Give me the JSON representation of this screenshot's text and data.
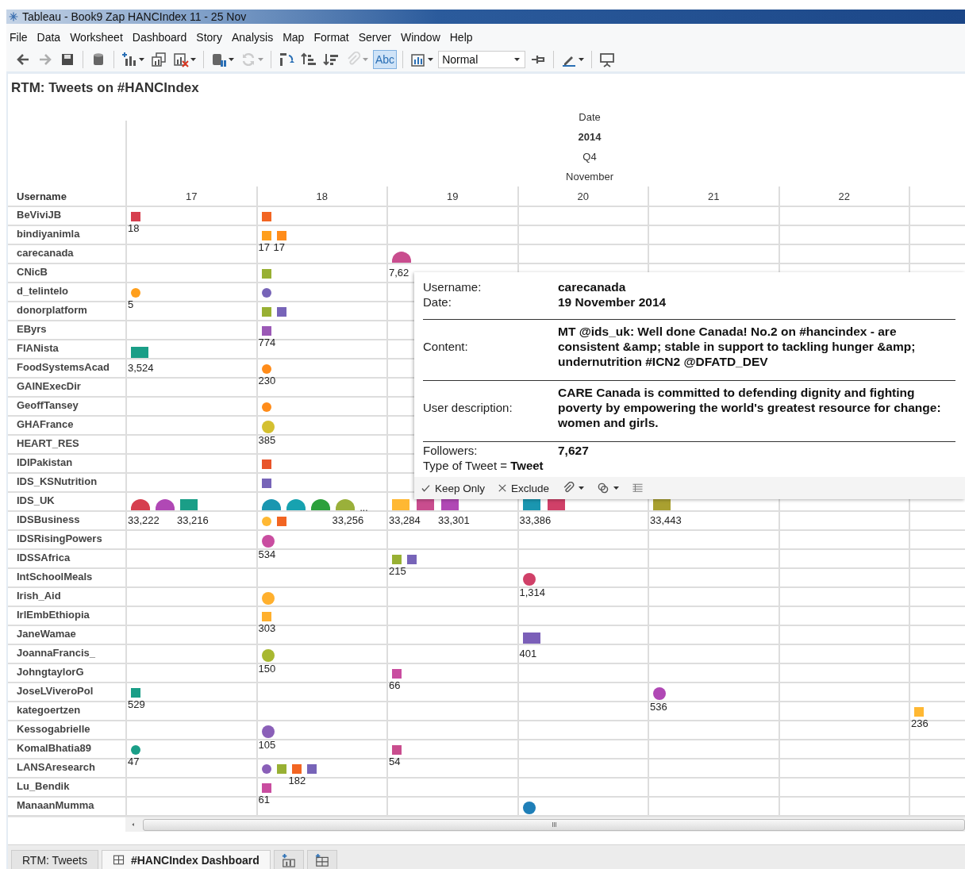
{
  "window": {
    "title": "Tableau - Book9 Zap HANCIndex 11 - 25 Nov"
  },
  "menu": [
    "File",
    "Data",
    "Worksheet",
    "Dashboard",
    "Story",
    "Analysis",
    "Map",
    "Format",
    "Server",
    "Window",
    "Help"
  ],
  "toolbar": [
    [
      {
        "kind": "icon",
        "disabled": false,
        "dropdown": false
      },
      {
        "kind": "icon",
        "disabled": true,
        "dropdown": false
      },
      {
        "kind": "icon",
        "disabled": false,
        "dropdown": false
      }
    ],
    [
      {
        "kind": "icon",
        "disabled": false,
        "dropdown": false
      }
    ],
    [
      {
        "kind": "icon",
        "disabled": false,
        "dropdown": true
      },
      {
        "kind": "icon",
        "disabled": false,
        "dropdown": false
      },
      {
        "kind": "icon",
        "disabled": false,
        "dropdown": true
      }
    ],
    [
      {
        "kind": "icon",
        "disabled": false,
        "dropdown": true
      },
      {
        "kind": "icon",
        "disabled": true,
        "dropdown": true
      }
    ],
    [
      {
        "kind": "icon",
        "disabled": false,
        "dropdown": false
      },
      {
        "kind": "icon",
        "disabled": false,
        "dropdown": false
      },
      {
        "kind": "icon",
        "disabled": false,
        "dropdown": false
      },
      {
        "kind": "icon",
        "disabled": true,
        "dropdown": true
      },
      {
        "kind": "toggle",
        "label": "Abc",
        "selected": true
      }
    ],
    [
      {
        "kind": "icon",
        "disabled": false,
        "dropdown": true
      },
      {
        "kind": "select",
        "value": "Normal"
      },
      {
        "kind": "icon",
        "disabled": false,
        "dropdown": false
      }
    ],
    [
      {
        "kind": "icon",
        "disabled": false,
        "dropdown": true
      }
    ],
    [
      {
        "kind": "icon",
        "disabled": false,
        "dropdown": false
      }
    ]
  ],
  "sheet_title": "RTM: Tweets on #HANCIndex",
  "header": {
    "field": "Date",
    "year": "2014",
    "quarter": "Q4",
    "month": "November",
    "row_field": "Username",
    "days": [
      "17",
      "18",
      "19",
      "20",
      "21",
      "22"
    ]
  },
  "rows": [
    {
      "username": "BeViviJB",
      "cells": [
        {
          "marks": [
            {
              "kind": "square",
              "color": "#d63f4f",
              "label": "18"
            }
          ]
        },
        {
          "marks": [
            {
              "kind": "square",
              "color": "#f26522"
            }
          ]
        }
      ]
    },
    {
      "username": "bindiyanimla",
      "cells": [
        {},
        {
          "marks": [
            {
              "kind": "square",
              "color": "#ff9f1c",
              "label": "17"
            },
            {
              "kind": "square",
              "color": "#ff8c1a",
              "label": "17"
            }
          ]
        }
      ]
    },
    {
      "username": "carecanada",
      "cells": [
        {},
        {},
        {
          "marks": [
            {
              "kind": "halfdisc",
              "color": "#c94d8e",
              "label": "7,62"
            }
          ]
        }
      ]
    },
    {
      "username": "CNicB",
      "cells": [
        {},
        {
          "marks": [
            {
              "kind": "square",
              "color": "#98b033"
            }
          ]
        }
      ]
    },
    {
      "username": "d_telintelo",
      "cells": [
        {
          "marks": [
            {
              "kind": "dot",
              "color": "#ff9f1c",
              "label": "5"
            }
          ]
        },
        {
          "marks": [
            {
              "kind": "dot",
              "color": "#7764b8"
            }
          ]
        }
      ]
    },
    {
      "username": "donorplatform",
      "cells": [
        {},
        {
          "marks": [
            {
              "kind": "square",
              "color": "#98b033"
            },
            {
              "kind": "square",
              "color": "#7764b8"
            }
          ]
        }
      ]
    },
    {
      "username": "EByrs",
      "cells": [
        {},
        {
          "marks": [
            {
              "kind": "square",
              "color": "#9b59b6",
              "label": "774"
            }
          ]
        }
      ]
    },
    {
      "username": "FIANista",
      "cells": [
        {
          "marks": [
            {
              "kind": "block",
              "color": "#1a9e87",
              "label": "3,524"
            }
          ]
        }
      ]
    },
    {
      "username": "FoodSystemsAcad",
      "cells": [
        {},
        {
          "marks": [
            {
              "kind": "dot",
              "color": "#ff8c1a",
              "label": "230"
            }
          ]
        }
      ]
    },
    {
      "username": "GAINExecDir",
      "cells": []
    },
    {
      "username": "GeoffTansey",
      "cells": [
        {},
        {
          "marks": [
            {
              "kind": "dot",
              "color": "#ff8c1a"
            }
          ]
        }
      ]
    },
    {
      "username": "GHAFrance",
      "cells": [
        {},
        {
          "marks": [
            {
              "kind": "circle",
              "color": "#d4c030",
              "label": "385"
            }
          ]
        }
      ]
    },
    {
      "username": "HEART_RES",
      "cells": []
    },
    {
      "username": "IDIPakistan",
      "cells": [
        {},
        {
          "marks": [
            {
              "kind": "square",
              "color": "#e8542a"
            }
          ]
        }
      ]
    },
    {
      "username": "IDS_KSNutrition",
      "cells": [
        {},
        {
          "marks": [
            {
              "kind": "square",
              "color": "#7764b8"
            }
          ]
        }
      ]
    },
    {
      "username": "IDS_UK",
      "cells": [
        {
          "marks": [
            {
              "kind": "halfdisc",
              "color": "#d63f4f",
              "label": "33,222"
            },
            {
              "kind": "halfdisc",
              "color": "#b048b5"
            },
            {
              "kind": "block",
              "color": "#1a9e87",
              "label": "33,216"
            }
          ]
        },
        {
          "marks": [
            {
              "kind": "halfdisc",
              "color": "#1a96b0"
            },
            {
              "kind": "halfdisc",
              "color": "#17a2b0"
            },
            {
              "kind": "halfdisc",
              "color": "#2ca03c"
            },
            {
              "kind": "halfdisc",
              "color": "#9ab03a",
              "label": "33,256"
            }
          ],
          "more": "..."
        },
        {
          "marks": [
            {
              "kind": "block",
              "color": "#ffb833",
              "label": "33,284"
            },
            {
              "kind": "block",
              "color": "#c94d8e"
            },
            {
              "kind": "block",
              "color": "#b048b5",
              "label": "33,301"
            }
          ]
        },
        {
          "marks": [
            {
              "kind": "block",
              "color": "#1a96b0",
              "label": "33,386"
            },
            {
              "kind": "block",
              "color": "#d04068"
            }
          ]
        },
        {
          "marks": [
            {
              "kind": "block",
              "color": "#a9a030",
              "label": "33,443"
            }
          ]
        }
      ]
    },
    {
      "username": "IDSBusiness",
      "cells": [
        {},
        {
          "marks": [
            {
              "kind": "dot",
              "color": "#ffb833"
            },
            {
              "kind": "square",
              "color": "#f26522"
            }
          ]
        }
      ]
    },
    {
      "username": "IDSRisingPowers",
      "cells": [
        {},
        {
          "marks": [
            {
              "kind": "circle",
              "color": "#c94da0",
              "label": "534"
            }
          ]
        }
      ]
    },
    {
      "username": "IDSSAfrica",
      "cells": [
        {},
        {},
        {
          "marks": [
            {
              "kind": "square",
              "color": "#98b033",
              "label": "215"
            },
            {
              "kind": "square",
              "color": "#7764b8"
            }
          ]
        }
      ]
    },
    {
      "username": "IntSchoolMeals",
      "cells": [
        {},
        {},
        {},
        {
          "marks": [
            {
              "kind": "circle",
              "color": "#d04068",
              "label": "1,314"
            }
          ]
        }
      ]
    },
    {
      "username": "Irish_Aid",
      "cells": [
        {},
        {
          "marks": [
            {
              "kind": "circle",
              "color": "#ffb02e"
            }
          ]
        }
      ]
    },
    {
      "username": "IrlEmbEthiopia",
      "cells": [
        {},
        {
          "marks": [
            {
              "kind": "square",
              "color": "#ffb02e",
              "label": "303"
            }
          ]
        }
      ]
    },
    {
      "username": "JaneWamae",
      "cells": [
        {},
        {},
        {},
        {
          "marks": [
            {
              "kind": "block",
              "color": "#7b5fb8",
              "label": "401"
            }
          ]
        }
      ]
    },
    {
      "username": "JoannaFrancis_",
      "cells": [
        {},
        {
          "marks": [
            {
              "kind": "circle",
              "color": "#a8b830",
              "label": "150"
            }
          ]
        }
      ]
    },
    {
      "username": "JohngtaylorG",
      "cells": [
        {},
        {},
        {
          "marks": [
            {
              "kind": "square",
              "color": "#c94da0",
              "label": "66"
            }
          ]
        }
      ]
    },
    {
      "username": "JoseLViveroPol",
      "cells": [
        {
          "marks": [
            {
              "kind": "square",
              "color": "#1a9e87",
              "label": "529"
            }
          ]
        },
        {},
        {},
        {},
        {
          "marks": [
            {
              "kind": "circle",
              "color": "#b048b5",
              "label": "536"
            }
          ]
        }
      ]
    },
    {
      "username": "kategoertzen",
      "cells": [
        {},
        {},
        {},
        {},
        {},
        {},
        {
          "marks": [
            {
              "kind": "square",
              "color": "#ffb833",
              "label": "236"
            }
          ]
        }
      ]
    },
    {
      "username": "Kessogabrielle",
      "cells": [
        {},
        {
          "marks": [
            {
              "kind": "circle",
              "color": "#8a5fb8",
              "label": "105"
            }
          ]
        }
      ]
    },
    {
      "username": "KomalBhatia89",
      "cells": [
        {
          "marks": [
            {
              "kind": "dot",
              "color": "#1a9e87",
              "label": "47"
            }
          ]
        },
        {},
        {
          "marks": [
            {
              "kind": "square",
              "color": "#c94d8e",
              "label": "54"
            }
          ]
        }
      ]
    },
    {
      "username": "LANSAresearch",
      "cells": [
        {},
        {
          "marks": [
            {
              "kind": "dot",
              "color": "#8a5fb8"
            },
            {
              "kind": "square",
              "color": "#98b033"
            },
            {
              "kind": "square",
              "color": "#f26522",
              "label": "182"
            },
            {
              "kind": "square",
              "color": "#7764b8"
            }
          ]
        }
      ]
    },
    {
      "username": "Lu_Bendik",
      "cells": [
        {},
        {
          "marks": [
            {
              "kind": "square",
              "color": "#c94da0",
              "label": "61"
            }
          ]
        }
      ]
    },
    {
      "username": "ManaanMumma",
      "cells": [
        {},
        {},
        {},
        {
          "marks": [
            {
              "kind": "circle",
              "color": "#1f7fb8"
            }
          ]
        }
      ]
    }
  ],
  "tooltip": {
    "fields": [
      {
        "label": "Username:",
        "value": "carecanada",
        "rule_above": false
      },
      {
        "label": "Date:",
        "value": "19 November 2014",
        "rule_above": false
      },
      {
        "label": "Content:",
        "value": "MT @ids_uk: Well done Canada! No.2 on #hancindex - are consistent &amp; stable in support to tackling hunger &amp; undernutrition #ICN2 @DFATD_DEV",
        "rule_above": true
      },
      {
        "label": "User description:",
        "value": "CARE Canada is committed to defending dignity and fighting poverty by empowering the world's greatest resource for change: women and girls.",
        "rule_above": true
      },
      {
        "label": "Followers:",
        "value": "7,627",
        "rule_above": true
      }
    ],
    "filter": "Type of Tweet  = **Tweet**",
    "actions": [
      "Keep Only",
      "Exclude"
    ]
  },
  "tabs": [
    {
      "label": "RTM: Tweets",
      "kind": "worksheet",
      "selected": false
    },
    {
      "label": "#HANCIndex Dashboard",
      "kind": "dashboard",
      "selected": true
    }
  ]
}
